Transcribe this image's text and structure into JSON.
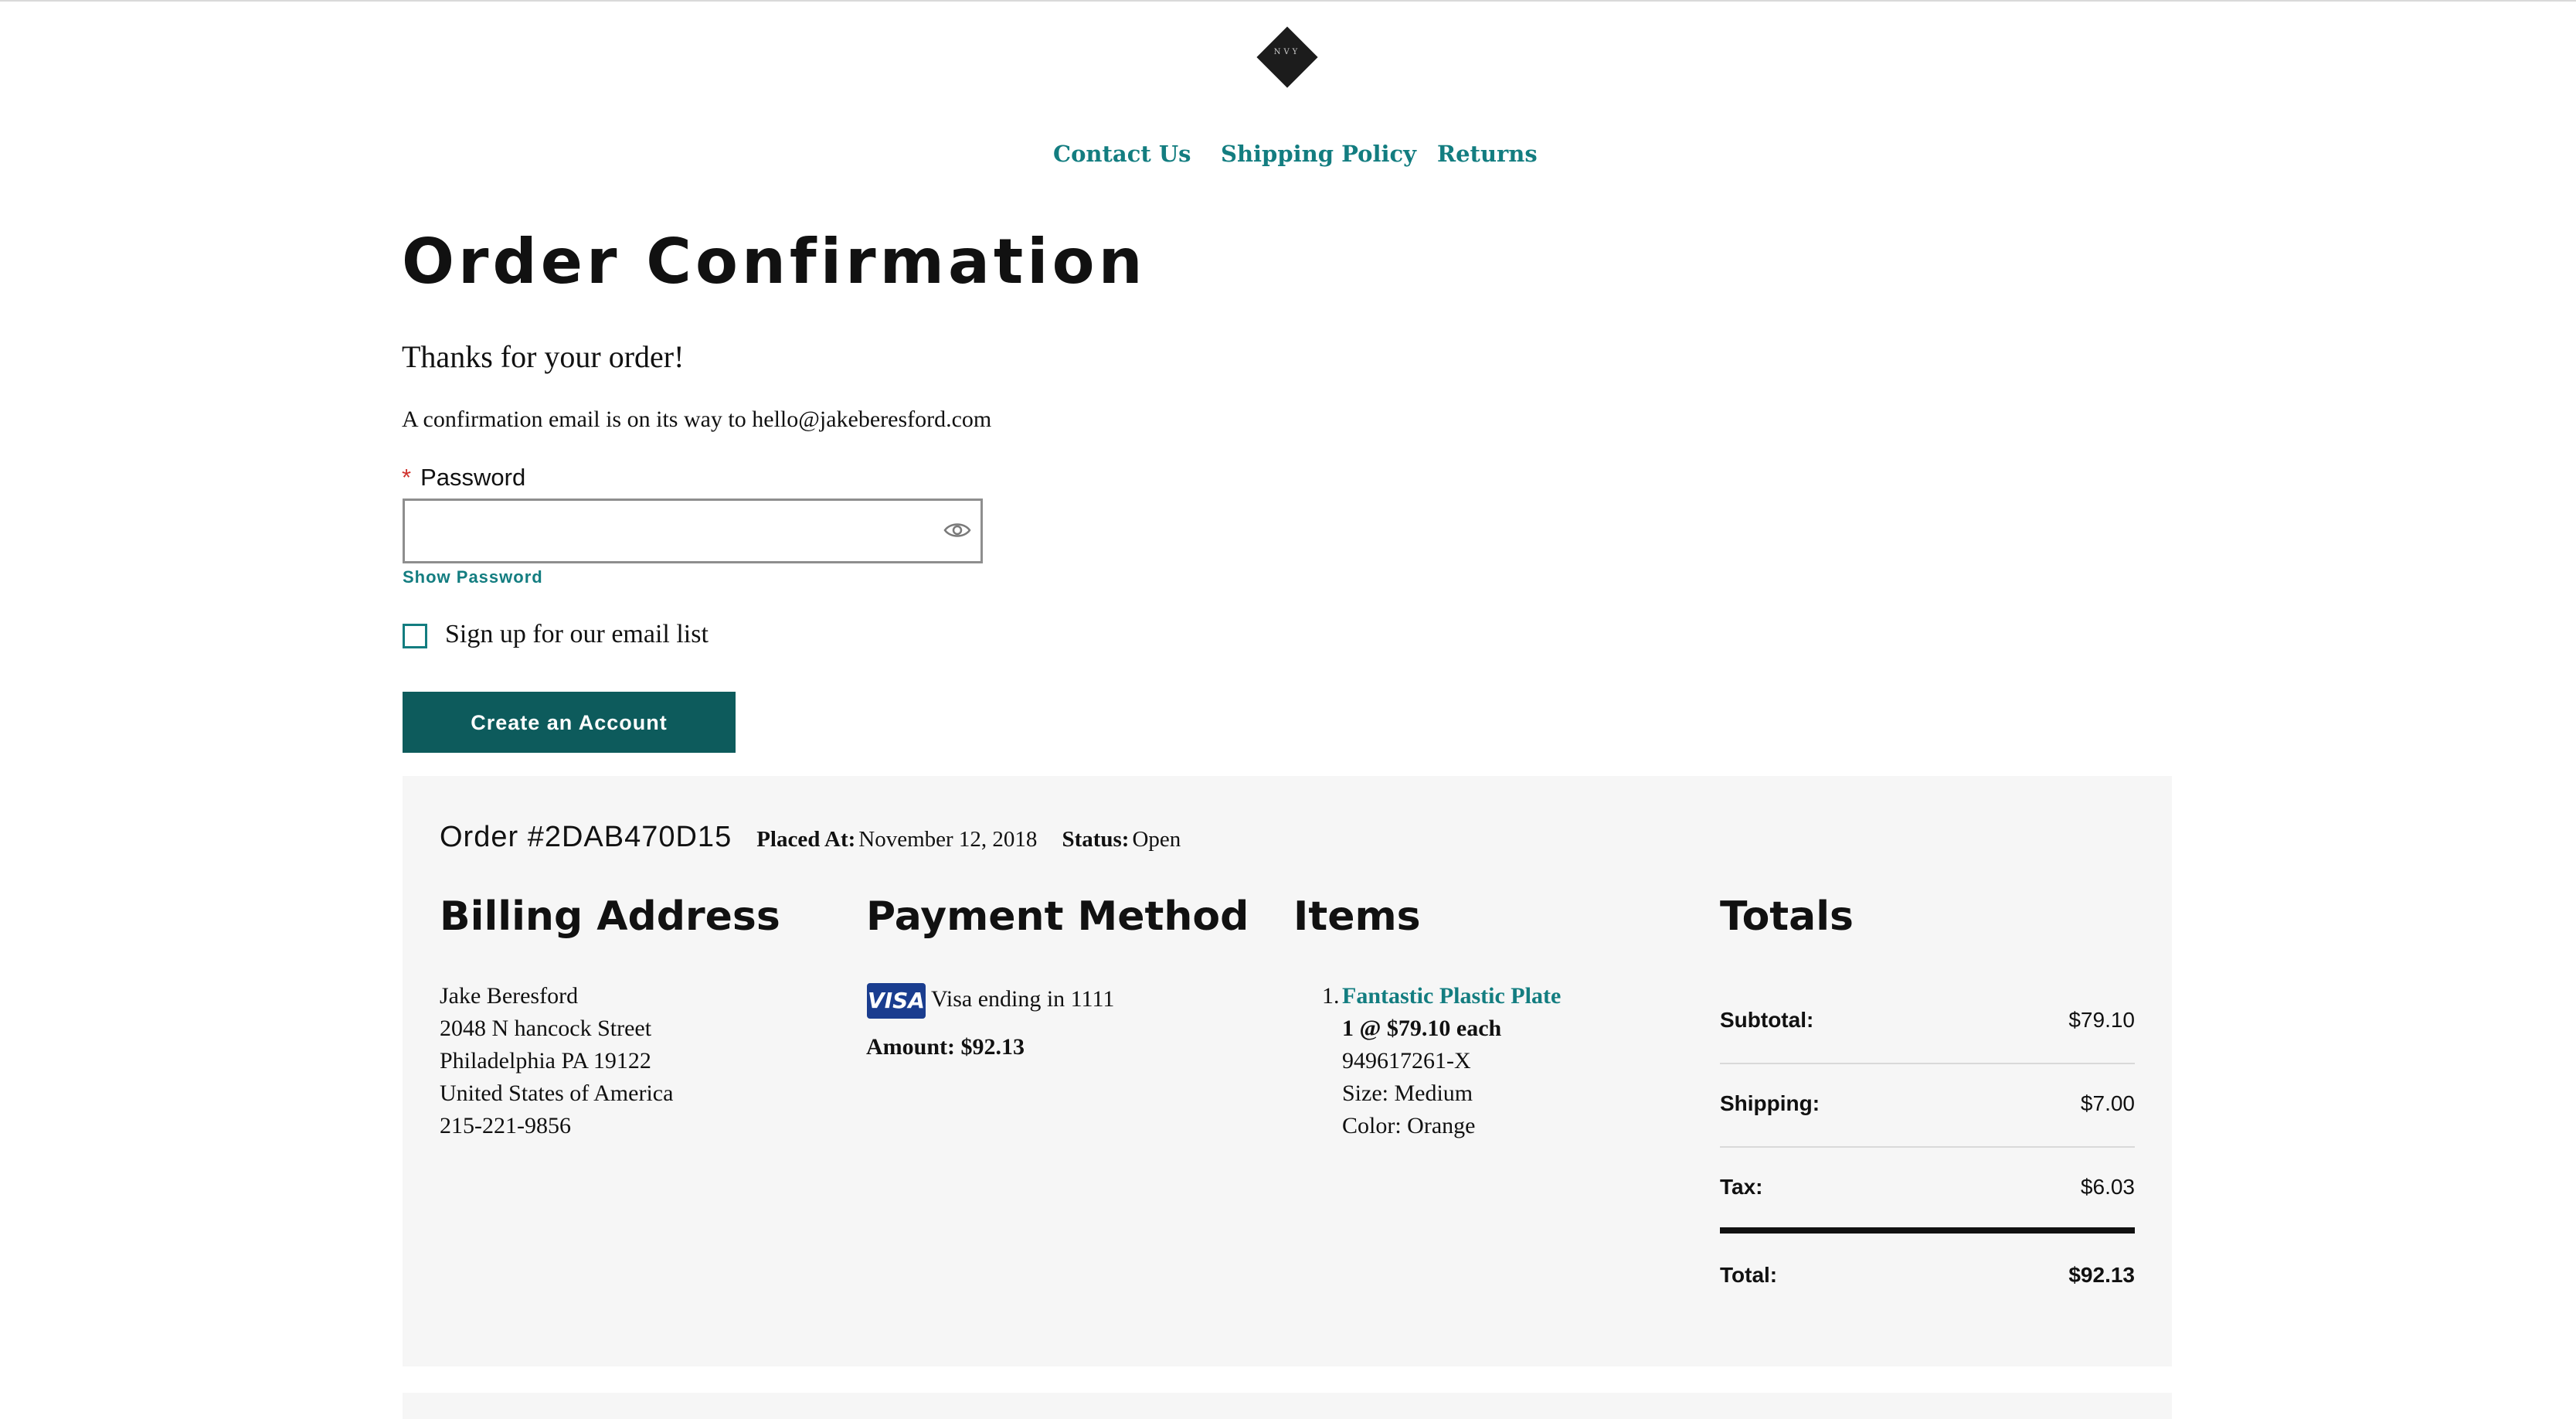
{
  "header": {
    "logo_text": "NVY",
    "nav": [
      "Contact Us",
      "Shipping Policy",
      "Returns"
    ]
  },
  "main": {
    "title": "Order Confirmation",
    "thanks": "Thanks for your order!",
    "confirmation_message": "A confirmation email is on its way to hello@jakeberesford.com",
    "password": {
      "required_mark": "*",
      "label": "Password",
      "value": "",
      "placeholder": "",
      "show_label": "Show Password"
    },
    "signup_checkbox": {
      "label": "Sign up for our email list",
      "checked": false
    },
    "create_account_label": "Create an Account"
  },
  "order": {
    "number": "Order #2DAB470D15",
    "placed_label": "Placed At:",
    "placed_value": "November 12, 2018",
    "status_label": "Status:",
    "status_value": "Open",
    "billing": {
      "heading": "Billing Address",
      "lines": [
        "Jake Beresford",
        "2048 N hancock Street",
        "Philadelphia PA 19122",
        "United States of America",
        "215-221-9856"
      ]
    },
    "payment": {
      "heading": "Payment Method",
      "card_brand": "VISA",
      "card_text": "Visa ending in 1111",
      "amount": "Amount: $92.13"
    },
    "items": {
      "heading": "Items",
      "list": [
        {
          "index": "1.",
          "name": "Fantastic Plastic Plate",
          "price_line": "1 @ $79.10 each",
          "sku": "949617261-X",
          "size": "Size: Medium",
          "color": "Color: Orange"
        }
      ]
    },
    "totals": {
      "heading": "Totals",
      "rows": [
        {
          "label": "Subtotal:",
          "value": "$79.10"
        },
        {
          "label": "Shipping:",
          "value": "$7.00"
        },
        {
          "label": "Tax:",
          "value": "$6.03"
        },
        {
          "label": "Total:",
          "value": "$92.13"
        }
      ]
    }
  },
  "colors": {
    "accent": "#137d80",
    "button": "#0d5b5c",
    "required": "#d0332e",
    "panel": "#f6f6f6",
    "visa": "#1a3d8f"
  },
  "icons": {
    "logo": "diamond-logo-icon",
    "password_toggle": "eye-icon",
    "card": "visa-icon"
  }
}
